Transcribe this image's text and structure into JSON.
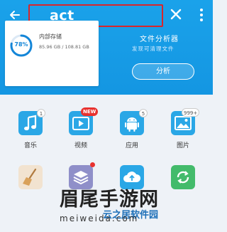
{
  "search": {
    "value": "act"
  },
  "storage": {
    "percent": 78,
    "percent_label": "78%",
    "title": "内部存储",
    "usage": "85.96 GB / 108.81 GB"
  },
  "analyzer": {
    "title": "文件分析器",
    "description": "发现可清理文件",
    "button_label": "分析"
  },
  "categories": [
    {
      "label": "音乐",
      "icon": "music-note-icon",
      "badge": "1",
      "color": "#29a8e8"
    },
    {
      "label": "视频",
      "icon": "video-play-icon",
      "badge": "NEW",
      "color": "#29a8e8"
    },
    {
      "label": "应用",
      "icon": "android-icon",
      "badge": "5",
      "color": "#29a8e8"
    },
    {
      "label": "图片",
      "icon": "image-icon",
      "badge": "999+",
      "color": "#29a8e8"
    }
  ],
  "tools": [
    {
      "icon": "broom-icon"
    },
    {
      "icon": "stack-icon"
    },
    {
      "icon": "cloud-upload-icon"
    },
    {
      "icon": "sync-icon"
    }
  ],
  "watermark": {
    "main": "眉尾手游网",
    "sub": "meiweida.com",
    "brand": "云之居软件园"
  },
  "colors": {
    "header_blue": "#1496e2",
    "accent_red": "#e8322f",
    "tile_blue": "#29a8e8"
  }
}
